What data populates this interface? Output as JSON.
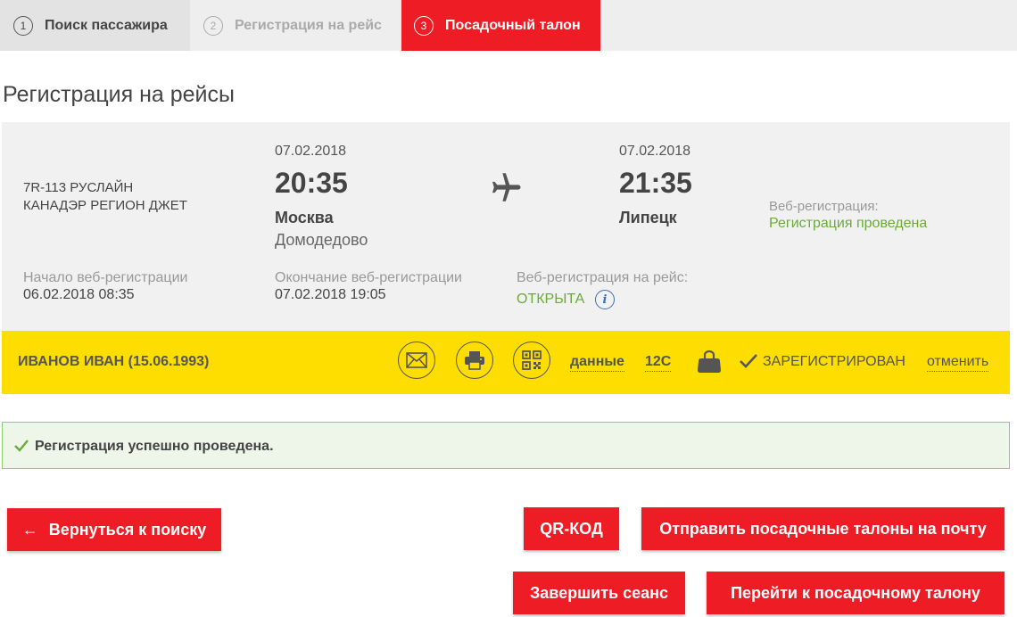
{
  "steps": [
    {
      "num": "1",
      "label": "Поиск пассажира",
      "state": "done"
    },
    {
      "num": "2",
      "label": "Регистрация на рейс",
      "state": "inactive"
    },
    {
      "num": "3",
      "label": "Посадочный талон",
      "state": "active"
    }
  ],
  "page_title": "Регистрация на рейсы",
  "flight": {
    "airline_line1": "7R-113 РУСЛАЙН",
    "airline_line2": "КАНАДЭР РЕГИОН ДЖЕТ",
    "departure": {
      "date": "07.02.2018",
      "time": "20:35",
      "city": "Москва",
      "airport": "Домодедово"
    },
    "arrival": {
      "date": "07.02.2018",
      "time": "21:35",
      "city": "Липецк"
    },
    "web_checkin_label": "Веб-регистрация:",
    "web_checkin_status": "Регистрация проведена",
    "start_label": "Начало веб-регистрации",
    "start_value": "06.02.2018 08:35",
    "end_label": "Окончание веб-регистрации",
    "end_value": "07.02.2018 19:05",
    "open_label": "Веб-регистрация на рейс:",
    "open_value": "ОТКРЫТА",
    "info_glyph": "i"
  },
  "passenger": {
    "name": "ИВАНОВ ИВАН (15.06.1993)",
    "data_link": "данные",
    "seat": "12C",
    "status": "ЗАРЕГИСТРИРОВАН",
    "cancel_link": "отменить"
  },
  "alert": {
    "text": "Регистрация успешно проведена."
  },
  "buttons": {
    "back_arrow": "←",
    "back": "Вернуться к поиску",
    "qr": "QR-КОД",
    "send": "Отправить посадочные талоны на почту",
    "finish": "Завершить сеанс",
    "goto": "Перейти к посадочному талону"
  },
  "colors": {
    "accent": "#ee1c25",
    "yellow": "#fedd00",
    "green": "#6aaa3a",
    "card_bg": "#f1f1f1"
  }
}
